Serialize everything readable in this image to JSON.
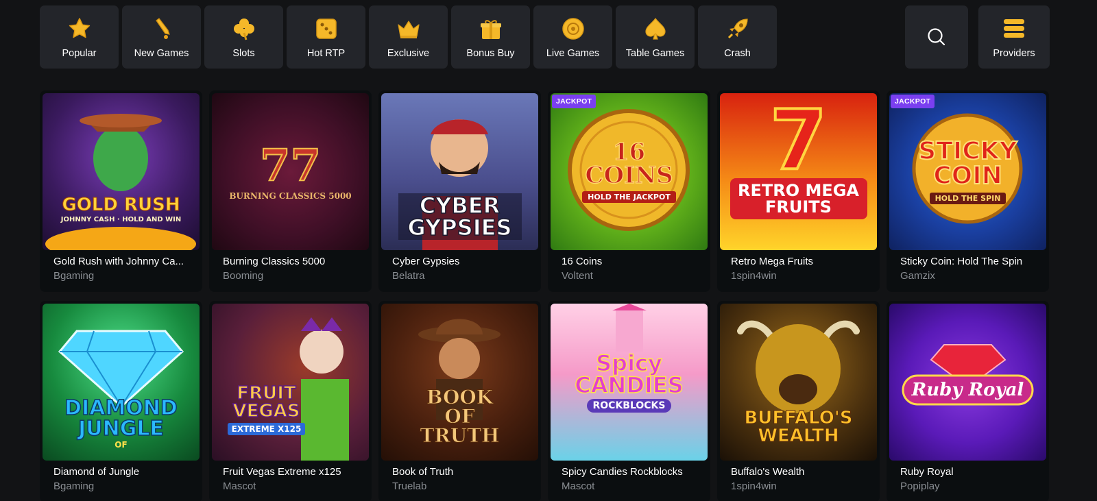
{
  "nav": {
    "categories": [
      {
        "label": "Popular",
        "icon": "star-icon"
      },
      {
        "label": "New Games",
        "icon": "bell-icon"
      },
      {
        "label": "Slots",
        "icon": "clover-icon"
      },
      {
        "label": "Hot RTP",
        "icon": "dice-icon"
      },
      {
        "label": "Exclusive",
        "icon": "crown-icon"
      },
      {
        "label": "Bonus Buy",
        "icon": "gift-icon"
      },
      {
        "label": "Live Games",
        "icon": "chip-icon"
      },
      {
        "label": "Table Games",
        "icon": "spade-icon"
      },
      {
        "label": "Crash",
        "icon": "rocket-icon"
      }
    ],
    "search_icon": "search-icon",
    "providers": {
      "label": "Providers",
      "icon": "stack-icon"
    }
  },
  "colors": {
    "accent_gold": "#f5b829",
    "badge_purple": "#7a3ff0",
    "card_bg": "#0b0e10",
    "nav_bg": "#23252a"
  },
  "games": [
    {
      "title": "Gold Rush with Johnny Ca...",
      "provider": "Bgaming",
      "badge": "",
      "art": "GOLD RUSH",
      "art_sub": "JOHNNY CASH · HOLD AND WIN"
    },
    {
      "title": "Burning Classics 5000",
      "provider": "Booming",
      "badge": "",
      "art": "77",
      "art_sub": "BURNING CLASSICS 5000"
    },
    {
      "title": "Cyber Gypsies",
      "provider": "Belatra",
      "badge": "",
      "art": "CYBER GYPSIES",
      "art_sub": ""
    },
    {
      "title": "16 Coins",
      "provider": "Voltent",
      "badge": "JACKPOT",
      "art": "16 COINS",
      "art_sub": "HOLD THE JACKPOT"
    },
    {
      "title": "Retro Mega Fruits",
      "provider": "1spin4win",
      "badge": "",
      "art": "RETRO MEGA FRUITS",
      "art_sub": "7"
    },
    {
      "title": "Sticky Coin: Hold The Spin",
      "provider": "Gamzix",
      "badge": "JACKPOT",
      "art": "STICKY COIN",
      "art_sub": "HOLD THE SPIN"
    },
    {
      "title": "Diamond of Jungle",
      "provider": "Bgaming",
      "badge": "",
      "art": "DIAMOND JUNGLE",
      "art_sub": "of"
    },
    {
      "title": "Fruit Vegas Extreme x125",
      "provider": "Mascot",
      "badge": "",
      "art": "FRUIT VEGAS",
      "art_sub": "EXTREME x125"
    },
    {
      "title": "Book of Truth",
      "provider": "Truelab",
      "badge": "",
      "art": "BOOK of TRUTH",
      "art_sub": ""
    },
    {
      "title": "Spicy Candies Rockblocks",
      "provider": "Mascot",
      "badge": "",
      "art": "Spicy CANDIES",
      "art_sub": "ROCKBLOCKS"
    },
    {
      "title": "Buffalo's Wealth",
      "provider": "1spin4win",
      "badge": "",
      "art": "BUFFALO'S WEALTH",
      "art_sub": ""
    },
    {
      "title": "Ruby Royal",
      "provider": "Popiplay",
      "badge": "",
      "art": "Ruby Royal",
      "art_sub": ""
    }
  ]
}
